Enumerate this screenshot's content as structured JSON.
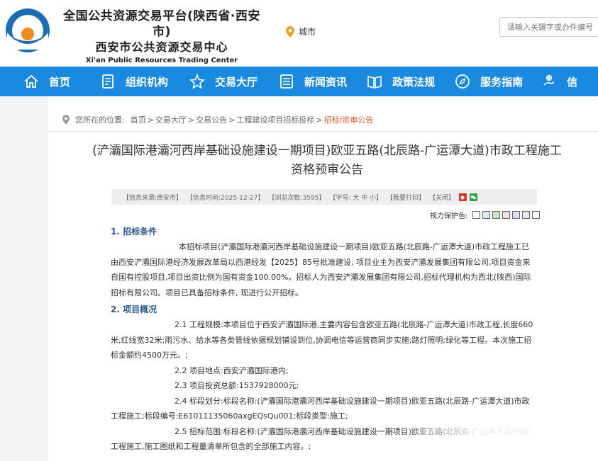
{
  "header": {
    "title_line1": "全国公共资源交易平台(陕西省·西安市)",
    "title_line2": "西安市公共资源交易中心",
    "title_line3": "Xi'an Public Resources Trading Center",
    "city_label": "城市",
    "search_placeholder": "请输入关键字或办件编号"
  },
  "nav": {
    "items": [
      {
        "label": "首页",
        "icon": "home-icon"
      },
      {
        "label": "组织机构",
        "icon": "document-icon"
      },
      {
        "label": "交易大厅",
        "icon": "star-icon"
      },
      {
        "label": "新闻资讯",
        "icon": "list-icon"
      },
      {
        "label": "政策法规",
        "icon": "book-icon"
      },
      {
        "label": "服务指南",
        "icon": "compass-icon"
      },
      {
        "label": "信",
        "icon": "hand-icon"
      }
    ]
  },
  "breadcrumb": {
    "prefix": "您所在的位置:",
    "items": [
      "首页",
      "交易大厅",
      "交易公告",
      "工程建设项目招标投标",
      "招标/资审公告"
    ]
  },
  "article": {
    "title_line1": "(浐灞国际港灞河西岸基础设施建设一期项目)欧亚五路(北辰路-广运潭大道)市政工程施工",
    "title_line2": "资格预审公告"
  },
  "infobar": {
    "source": "【信息来源:西安市】",
    "time": "【信息时间:2025-12-27】",
    "views": "【浏览次数:3595】",
    "fontsize": "【字号: 大 中 小】",
    "print": "【我要打印】",
    "close": "【关闭】"
  },
  "eyecare": {
    "label": "视力保护色:",
    "colors": [
      "#ffffff",
      "#dce9f5",
      "#cfe3c7",
      "#f2e0e6",
      "#e3dbf2",
      "#e8e8e8",
      "#ffffff"
    ]
  },
  "content": {
    "s1_heading": "1. 招标条件",
    "s1_body": "本招标项目(浐灞国际港灞河西岸基础设施建设一期项目)欧亚五路(北辰路-广运潭大道)市政工程施工已由西安浐灞国际港经济发展改革局以西港经发【2025】85号批准建设, 项目业主为西安浐灞发展集团有限公司,项目资金来自国有控股项目,项目出资比例为国有资金100.00%。招标人为西安浐灞发展集团有限公司,招标代理机构为西北(陕西)国际招标有限公司。项目已具备招标条件, 现进行公开招标。",
    "s2_heading": "2. 项目概况",
    "p21": "2.1 工程规模:本项目位于西安浐灞国际港,主要内容包含欧亚五路(北辰路-广运潭大道)市政工程,长度660米,红线宽32米;雨污水、给水等各类管线依据规划铺设到位,协调电信等运营商同步实施;路灯照明;绿化等工程。本次施工招标金额约4500万元。;",
    "p22": "2.2 项目地点:西安浐灞国际港内;",
    "p23": "2.3 项目投资总额:1537928000元;",
    "p24": "2.4 标段划分:标段名称:(浐灞国际港灞河西岸基础设施建设一期项目)欧亚五路(北辰路-广运潭大道)市政工程施工;标段编号:E61011135060axgEQsQu001;标段类型:施工;",
    "p25": "2.5 招标范围:标段名称:(浐灞国际港灞河西岸基础设施建设一期项目)欧亚五路(北辰路-广运潭大道)市政工程施工,施工图纸和工程量清单所包含的全部施工内容。;"
  }
}
